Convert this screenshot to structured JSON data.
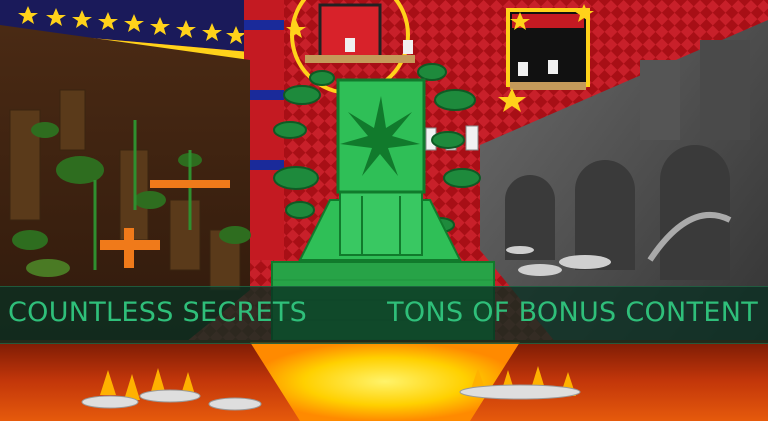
{
  "banner": {
    "left_text": "COUNTLESS SECRETS",
    "right_text": "TONS OF BONUS CONTENT"
  },
  "colors": {
    "banner_bg": "#0a3022",
    "banner_text": "#2fbf7a",
    "statue_green": "#2fa34e",
    "theater_red": "#b3141b",
    "star_yellow": "#ffd21a",
    "lava": "#ffd000",
    "gray_ruins": "#5e5e5e",
    "forest_dirt": "#6b3a1c"
  },
  "icons": {
    "statue": "green-star-statue",
    "stars": "star-icon",
    "coins": "green-coin-icon",
    "trophies": "trophy-icon"
  }
}
